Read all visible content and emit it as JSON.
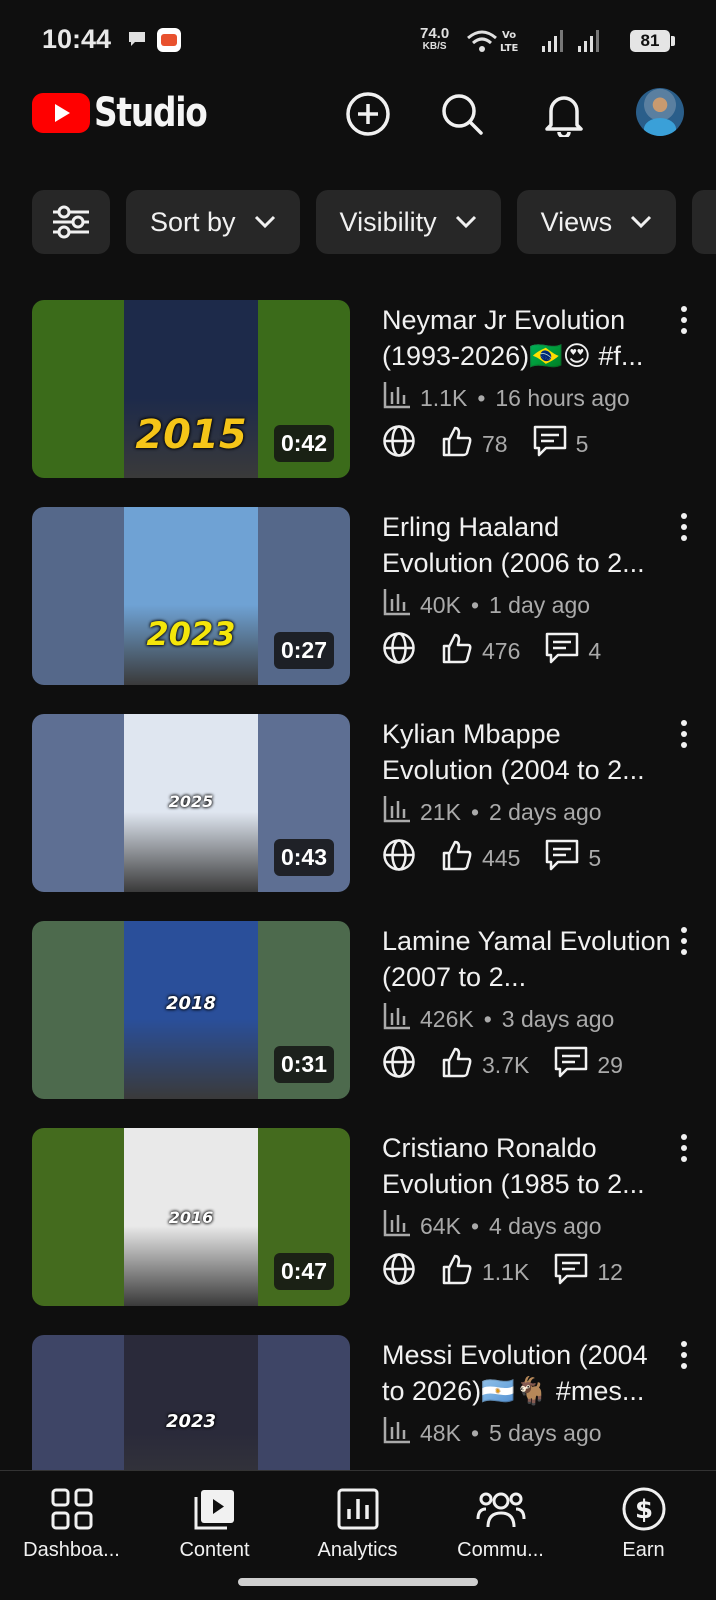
{
  "status_bar": {
    "time": "10:44",
    "net_speed_value": "74.0",
    "net_speed_unit": "KB/S",
    "volte_label": "Vo LTE",
    "battery": "81"
  },
  "header": {
    "app_name": "Studio",
    "brand_color": "#ff0000"
  },
  "filters": [
    {
      "label": "Sort by"
    },
    {
      "label": "Visibility"
    },
    {
      "label": "Views"
    }
  ],
  "videos": [
    {
      "title": "Neymar Jr Evolution (1993-2026)🇧🇷😍 #f...",
      "views": "1.1K",
      "age": "16 hours ago",
      "likes": "78",
      "comments": "5",
      "duration": "0:42",
      "year": "2015",
      "bg": "#3b6b1a",
      "center": "#1d2a4a",
      "year_color": "#f5c518"
    },
    {
      "title": "Erling Haaland Evolution (2006 to 2...",
      "views": "40K",
      "age": "1 day ago",
      "likes": "476",
      "comments": "4",
      "duration": "0:27",
      "year": "2023",
      "bg": "#55688a",
      "center": "#6fa2d4",
      "year_color": "#f5e60a"
    },
    {
      "title": "Kylian Mbappe Evolution (2004 to 2...",
      "views": "21K",
      "age": "2 days ago",
      "likes": "445",
      "comments": "5",
      "duration": "0:43",
      "year": "2025",
      "bg": "#5e6f93",
      "center": "#dfe6f0",
      "year_color": "#ffffff"
    },
    {
      "title": "Lamine Yamal Evolution (2007 to 2...",
      "views": "426K",
      "age": "3 days ago",
      "likes": "3.7K",
      "comments": "29",
      "duration": "0:31",
      "year": "2018",
      "bg": "#4d6a4d",
      "center": "#2a4f9a",
      "year_color": "#ffffff"
    },
    {
      "title": "Cristiano Ronaldo Evolution (1985 to 2...",
      "views": "64K",
      "age": "4 days ago",
      "likes": "1.1K",
      "comments": "12",
      "duration": "0:47",
      "year": "2016",
      "bg": "#446b1e",
      "center": "#e9e9e9",
      "year_color": "#ffffff"
    },
    {
      "title": "Messi Evolution (2004 to 2026)🇦🇷🐐 #mes...",
      "views": "48K",
      "age": "5 days ago",
      "likes": "",
      "comments": "",
      "duration": "",
      "year": "2023",
      "bg": "#3e4566",
      "center": "#2a2a3a",
      "year_color": "#ffffff"
    }
  ],
  "bottom_nav": [
    {
      "label": "Dashboa...",
      "icon": "dashboard-icon"
    },
    {
      "label": "Content",
      "icon": "content-icon"
    },
    {
      "label": "Analytics",
      "icon": "analytics-icon"
    },
    {
      "label": "Commu...",
      "icon": "community-icon"
    },
    {
      "label": "Earn",
      "icon": "earn-icon"
    }
  ]
}
